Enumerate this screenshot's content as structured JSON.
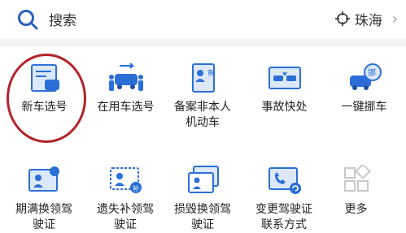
{
  "search": {
    "label": "搜索"
  },
  "location": {
    "city": "珠海"
  },
  "services": [
    {
      "label": "新车选号",
      "icon": "new-car-plate-icon"
    },
    {
      "label": "在用车选号",
      "icon": "used-car-plate-icon"
    },
    {
      "label": "备案非本人机动车",
      "icon": "vehicle-filing-icon"
    },
    {
      "label": "事故快处",
      "icon": "accident-handling-icon"
    },
    {
      "label": "一键挪车",
      "icon": "move-car-icon"
    },
    {
      "label": "期满换领驾驶证",
      "icon": "license-renew-icon"
    },
    {
      "label": "遗失补领驾驶证",
      "icon": "license-replace-icon"
    },
    {
      "label": "损毁换领驾驶证",
      "icon": "license-damage-icon"
    },
    {
      "label": "变更驾驶证联系方式",
      "icon": "license-contact-icon"
    },
    {
      "label": "更多",
      "icon": "more-icon"
    }
  ],
  "colors": {
    "accent": "#2b6fd6",
    "circle": "#b3232a",
    "icon_light": "#dce8fb"
  }
}
